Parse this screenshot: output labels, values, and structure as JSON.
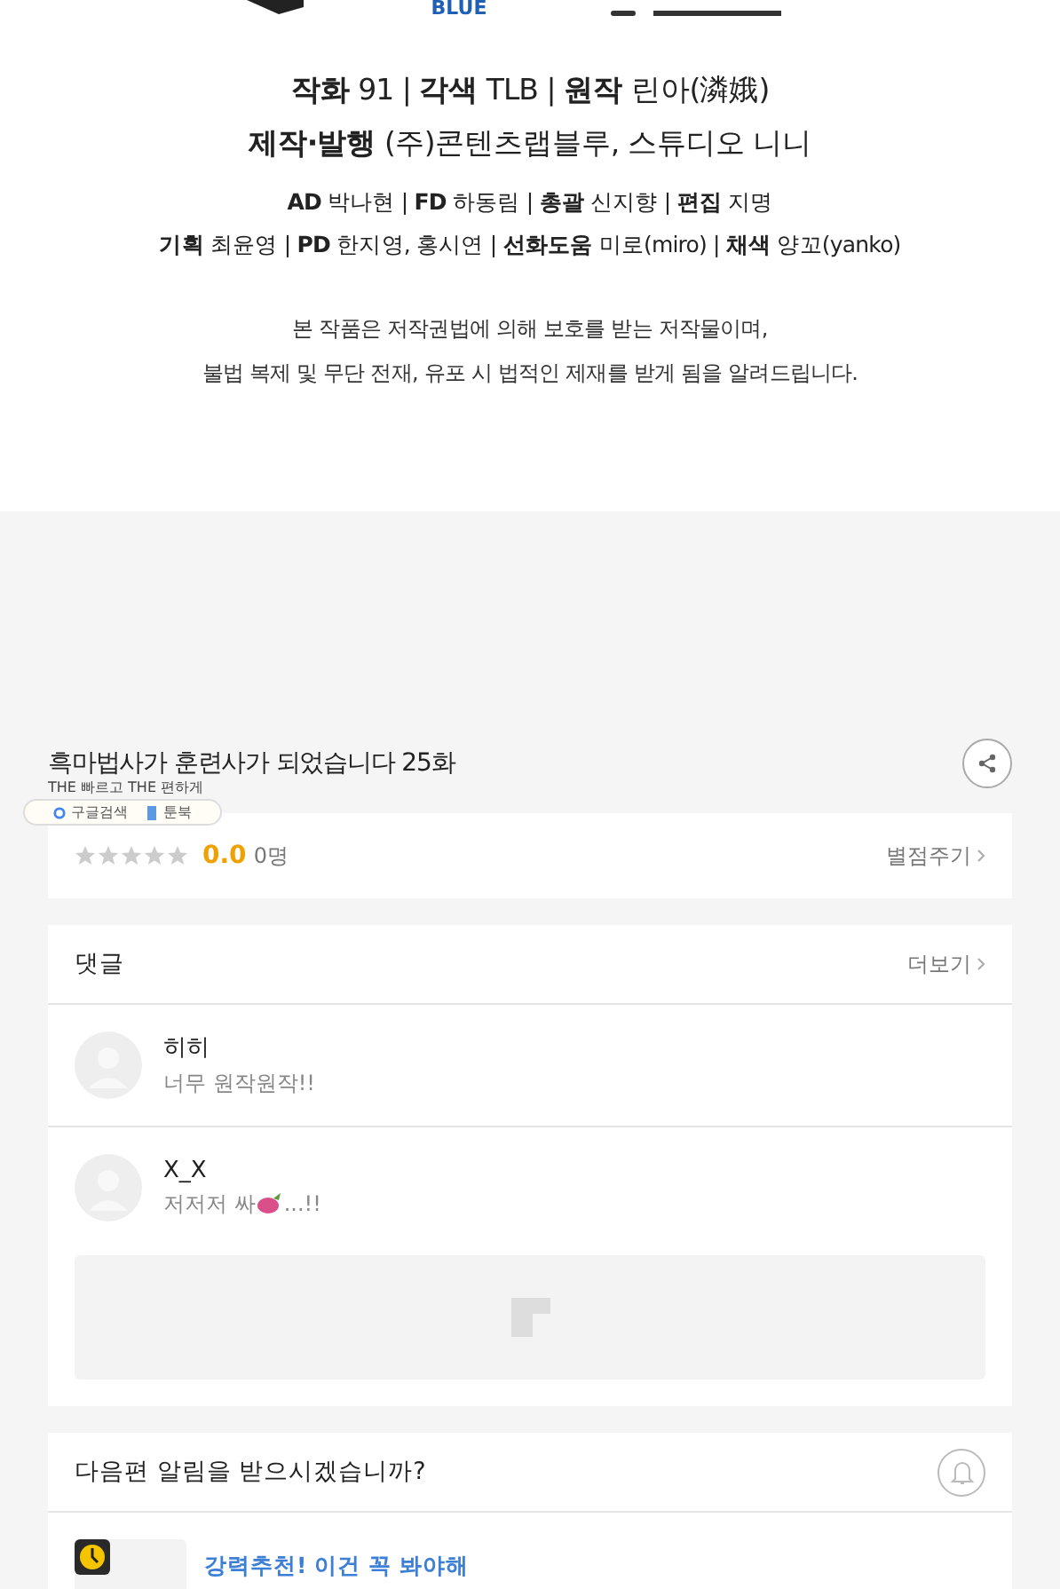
{
  "logos": [
    {
      "text": "BLUE"
    }
  ],
  "credits": {
    "main": [
      "**작화** 91 | **각색** TLB | **원작** 린아(潾娥)",
      "**제작·발행** (주)콘텐츠랩블루, 스튜디오 니니"
    ],
    "staff": [
      "**AD** 박나현 | **FD** 하동림 | **총괄** 신지향 | **편집** 지명",
      "**기획** 최윤영 | **PD** 한지영, 홍시연 | **선화도움** 미로(miro) | **채색** 양꼬(yanko)"
    ],
    "notice": [
      "본 작품은 저작권법에 의해 보호를 받는 저작물이며,",
      "불법 복제 및 무단 전재, 유포 시 법적인 제재를 받게 됨을 알려드립니다."
    ]
  },
  "episode": {
    "title": "흑마법사가 훈련사가 되었습니다 25화"
  },
  "overlay": {
    "tagline": "THE 빠르고 THE 편하게",
    "links": [
      "구글검색",
      "툰북"
    ]
  },
  "rating": {
    "stars": 0,
    "score": "0.0",
    "count": "0명",
    "action": "별점주기"
  },
  "comments": {
    "title": "댓글",
    "more": "더보기",
    "items": [
      {
        "author": "히히",
        "text": "너무 원작원작!!",
        "sticker": false
      },
      {
        "author": "X_X",
        "text": "저저저 싸",
        "sticker": true,
        "text_after": "...!!"
      }
    ]
  },
  "notify": {
    "question": "다음편 알림을 받으시겠습니까?",
    "on": false
  },
  "recommend": {
    "title": "강력추천! 이건 꼭 봐야해"
  }
}
